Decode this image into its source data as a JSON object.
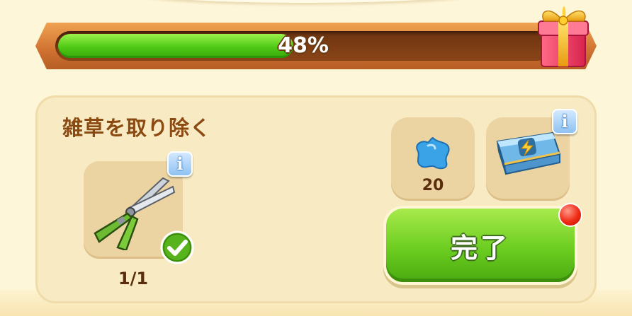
{
  "progress": {
    "percent": 48,
    "label": "48%"
  },
  "task": {
    "title": "雑草を取り除く",
    "tool": {
      "icon": "garden-shears-icon",
      "count_label": "1/1",
      "completed": true
    },
    "rewards": [
      {
        "icon": "blue-gem-icon",
        "value": "20"
      },
      {
        "icon": "energy-chest-icon"
      }
    ]
  },
  "buttons": {
    "complete_label": "完了"
  },
  "icons": {
    "info": "i"
  },
  "colors": {
    "accent_green": "#6ccd20",
    "progress_frame": "#cf7131",
    "title_brown": "#8a4a12",
    "notification_red": "#ef2a14"
  }
}
